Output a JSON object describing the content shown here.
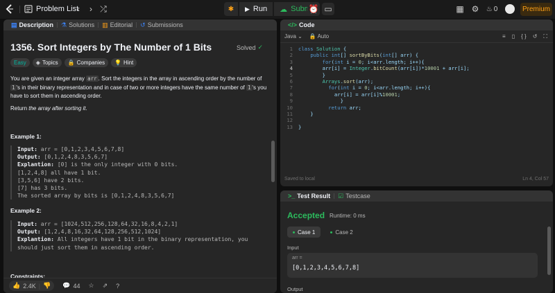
{
  "topbar": {
    "problem_list": "Problem List",
    "run": "Run",
    "submit": "Submit",
    "streak": "0",
    "premium": "Premium"
  },
  "left_tabs": [
    {
      "label": "Description",
      "icon": "description-icon"
    },
    {
      "label": "Solutions",
      "icon": "flask-icon"
    },
    {
      "label": "Editorial",
      "icon": "book-icon"
    },
    {
      "label": "Submissions",
      "icon": "history-icon"
    }
  ],
  "problem": {
    "title": "1356. Sort Integers by The Number of 1 Bits",
    "status": "Solved",
    "chips": {
      "difficulty": "Easy",
      "topics": "Topics",
      "companies": "Companies",
      "hint": "Hint"
    },
    "p1_a": "You are given an integer array ",
    "p1_code1": "arr",
    "p1_b": ". Sort the integers in the array in ascending order by the number of",
    "p1_code2": "1",
    "p1_c": "'s in their binary representation and in case of two or more integers have the same number of ",
    "p1_code3": "1",
    "p1_d": "'s you have to sort them in ascending order.",
    "p2_a": "Return ",
    "p2_em": "the array after sorting it",
    "p2_b": ".",
    "ex1_title": "Example 1:",
    "ex1_lines": {
      "input_label": "Input:",
      "input": "arr = [0,1,2,3,4,5,6,7,8]",
      "output_label": "Output:",
      "output": "[0,1,2,4,8,3,5,6,7]",
      "expl_label": "Explantion:",
      "expl": "[0] is the only integer with 0 bits.",
      "l1": "[1,2,4,8] all have 1 bit.",
      "l2": "[3,5,6] have 2 bits.",
      "l3": "[7] has 3 bits.",
      "l4": "The sorted array by bits is [0,1,2,4,8,3,5,6,7]"
    },
    "ex2_title": "Example 2:",
    "ex2_lines": {
      "input_label": "Input:",
      "input": "arr = [1024,512,256,128,64,32,16,8,4,2,1]",
      "output_label": "Output:",
      "output": "[1,2,4,8,16,32,64,128,256,512,1024]",
      "expl_label": "Explantion:",
      "expl": "All integers have 1 bit in the binary representation, you",
      "l1": "should just sort them in ascending order."
    },
    "constraints": "Constraints:"
  },
  "left_footer": {
    "likes": "2.4K",
    "comments": "44"
  },
  "code": {
    "tab": "Code",
    "language": "Java",
    "mode": "Auto",
    "saved": "Saved to local",
    "position": "Ln 4, Col 57"
  },
  "test": {
    "tab_result": "Test Result",
    "tab_testcase": "Testcase",
    "verdict": "Accepted",
    "runtime": "Runtime: 0 ms",
    "case1": "Case 1",
    "case2": "Case 2",
    "input_label": "Input",
    "var": "arr =",
    "value": "[0,1,2,3,4,5,6,7,8]",
    "output_label": "Output"
  },
  "colors": {
    "accent": "#ffa116",
    "success": "#2cbb5d",
    "easy": "#00b8a3"
  }
}
